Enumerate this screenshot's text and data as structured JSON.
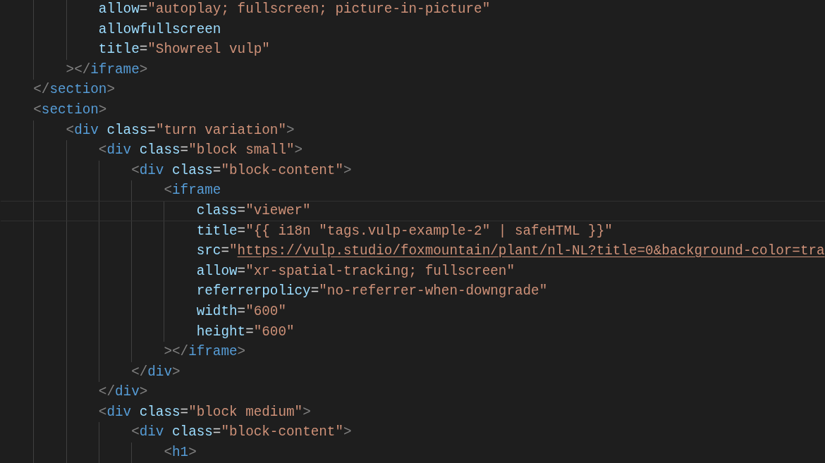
{
  "lines": [
    {
      "children": [
        {
          "children": [
            {
              "children": [
                {
                  "current": false,
                  "tokens": [
                    {
                      "kind": "attr",
                      "text": "allow"
                    },
                    {
                      "kind": "eq",
                      "text": "="
                    },
                    {
                      "kind": "str",
                      "text": "\"autoplay; fullscreen; picture-in-picture\""
                    }
                  ]
                },
                {
                  "current": false,
                  "tokens": [
                    {
                      "kind": "attr",
                      "text": "allowfullscreen"
                    }
                  ]
                },
                {
                  "current": false,
                  "tokens": [
                    {
                      "kind": "attr",
                      "text": "title"
                    },
                    {
                      "kind": "eq",
                      "text": "="
                    },
                    {
                      "kind": "str",
                      "text": "\"Showreel vulp\""
                    }
                  ]
                }
              ]
            },
            {
              "current": false,
              "tokens": [
                {
                  "kind": "punct",
                  "text": "></"
                },
                {
                  "kind": "tag",
                  "text": "iframe"
                },
                {
                  "kind": "punct",
                  "text": ">"
                }
              ]
            }
          ]
        },
        {
          "current": false,
          "tokens": [
            {
              "kind": "punct",
              "text": "</"
            },
            {
              "kind": "tag",
              "text": "section"
            },
            {
              "kind": "punct",
              "text": ">"
            }
          ]
        },
        {
          "current": false,
          "tokens": [
            {
              "kind": "punct",
              "text": "<"
            },
            {
              "kind": "tag",
              "text": "section"
            },
            {
              "kind": "punct",
              "text": ">"
            }
          ],
          "children": [
            {
              "current": false,
              "tokens": [
                {
                  "kind": "punct",
                  "text": "<"
                },
                {
                  "kind": "tag",
                  "text": "div"
                },
                {
                  "kind": "attr",
                  "text": " class"
                },
                {
                  "kind": "eq",
                  "text": "="
                },
                {
                  "kind": "str",
                  "text": "\"turn variation\""
                },
                {
                  "kind": "punct",
                  "text": ">"
                }
              ],
              "children": [
                {
                  "current": false,
                  "tokens": [
                    {
                      "kind": "punct",
                      "text": "<"
                    },
                    {
                      "kind": "tag",
                      "text": "div"
                    },
                    {
                      "kind": "attr",
                      "text": " class"
                    },
                    {
                      "kind": "eq",
                      "text": "="
                    },
                    {
                      "kind": "str",
                      "text": "\"block small\""
                    },
                    {
                      "kind": "punct",
                      "text": ">"
                    }
                  ],
                  "children": [
                    {
                      "current": false,
                      "tokens": [
                        {
                          "kind": "punct",
                          "text": "<"
                        },
                        {
                          "kind": "tag",
                          "text": "div"
                        },
                        {
                          "kind": "attr",
                          "text": " class"
                        },
                        {
                          "kind": "eq",
                          "text": "="
                        },
                        {
                          "kind": "str",
                          "text": "\"block-content\""
                        },
                        {
                          "kind": "punct",
                          "text": ">"
                        }
                      ],
                      "children": [
                        {
                          "current": false,
                          "tokens": [
                            {
                              "kind": "punct",
                              "text": "<"
                            },
                            {
                              "kind": "tag",
                              "text": "iframe"
                            }
                          ],
                          "children": [
                            {
                              "current": true,
                              "tokens": [
                                {
                                  "kind": "attr",
                                  "text": "class"
                                },
                                {
                                  "kind": "eq",
                                  "text": "="
                                },
                                {
                                  "kind": "str",
                                  "text": "\"viewer\""
                                }
                              ]
                            },
                            {
                              "current": false,
                              "tokens": [
                                {
                                  "kind": "attr",
                                  "text": "title"
                                },
                                {
                                  "kind": "eq",
                                  "text": "="
                                },
                                {
                                  "kind": "str",
                                  "text": "\"{{ i18n \"tags.vulp-example-2\" | safeHTML }}\""
                                }
                              ]
                            },
                            {
                              "current": false,
                              "tokens": [
                                {
                                  "kind": "attr",
                                  "text": "src"
                                },
                                {
                                  "kind": "eq",
                                  "text": "="
                                },
                                {
                                  "kind": "str",
                                  "text": "\""
                                },
                                {
                                  "kind": "link",
                                  "text": "https://vulp.studio/foxmountain/plant/nl-NL?title=0&background-color=tra"
                                }
                              ]
                            },
                            {
                              "current": false,
                              "tokens": [
                                {
                                  "kind": "attr",
                                  "text": "allow"
                                },
                                {
                                  "kind": "eq",
                                  "text": "="
                                },
                                {
                                  "kind": "str",
                                  "text": "\"xr-spatial-tracking; fullscreen\""
                                }
                              ]
                            },
                            {
                              "current": false,
                              "tokens": [
                                {
                                  "kind": "attr",
                                  "text": "referrerpolicy"
                                },
                                {
                                  "kind": "eq",
                                  "text": "="
                                },
                                {
                                  "kind": "str",
                                  "text": "\"no-referrer-when-downgrade\""
                                }
                              ]
                            },
                            {
                              "current": false,
                              "tokens": [
                                {
                                  "kind": "attr",
                                  "text": "width"
                                },
                                {
                                  "kind": "eq",
                                  "text": "="
                                },
                                {
                                  "kind": "str",
                                  "text": "\"600\""
                                }
                              ]
                            },
                            {
                              "current": false,
                              "tokens": [
                                {
                                  "kind": "attr",
                                  "text": "height"
                                },
                                {
                                  "kind": "eq",
                                  "text": "="
                                },
                                {
                                  "kind": "str",
                                  "text": "\"600\""
                                }
                              ]
                            }
                          ]
                        },
                        {
                          "current": false,
                          "tokens": [
                            {
                              "kind": "punct",
                              "text": "></"
                            },
                            {
                              "kind": "tag",
                              "text": "iframe"
                            },
                            {
                              "kind": "punct",
                              "text": ">"
                            }
                          ]
                        }
                      ]
                    },
                    {
                      "current": false,
                      "tokens": [
                        {
                          "kind": "punct",
                          "text": "</"
                        },
                        {
                          "kind": "tag",
                          "text": "div"
                        },
                        {
                          "kind": "punct",
                          "text": ">"
                        }
                      ]
                    }
                  ]
                },
                {
                  "current": false,
                  "tokens": [
                    {
                      "kind": "punct",
                      "text": "</"
                    },
                    {
                      "kind": "tag",
                      "text": "div"
                    },
                    {
                      "kind": "punct",
                      "text": ">"
                    }
                  ]
                },
                {
                  "current": false,
                  "tokens": [
                    {
                      "kind": "punct",
                      "text": "<"
                    },
                    {
                      "kind": "tag",
                      "text": "div"
                    },
                    {
                      "kind": "attr",
                      "text": " class"
                    },
                    {
                      "kind": "eq",
                      "text": "="
                    },
                    {
                      "kind": "str",
                      "text": "\"block medium\""
                    },
                    {
                      "kind": "punct",
                      "text": ">"
                    }
                  ],
                  "children": [
                    {
                      "current": false,
                      "tokens": [
                        {
                          "kind": "punct",
                          "text": "<"
                        },
                        {
                          "kind": "tag",
                          "text": "div"
                        },
                        {
                          "kind": "attr",
                          "text": " class"
                        },
                        {
                          "kind": "eq",
                          "text": "="
                        },
                        {
                          "kind": "str",
                          "text": "\"block-content\""
                        },
                        {
                          "kind": "punct",
                          "text": ">"
                        }
                      ],
                      "children": [
                        {
                          "current": false,
                          "tokens": [
                            {
                              "kind": "punct",
                              "text": "<"
                            },
                            {
                              "kind": "tag",
                              "text": "h1"
                            },
                            {
                              "kind": "punct",
                              "text": ">"
                            }
                          ]
                        }
                      ]
                    }
                  ]
                }
              ]
            }
          ]
        }
      ]
    }
  ]
}
